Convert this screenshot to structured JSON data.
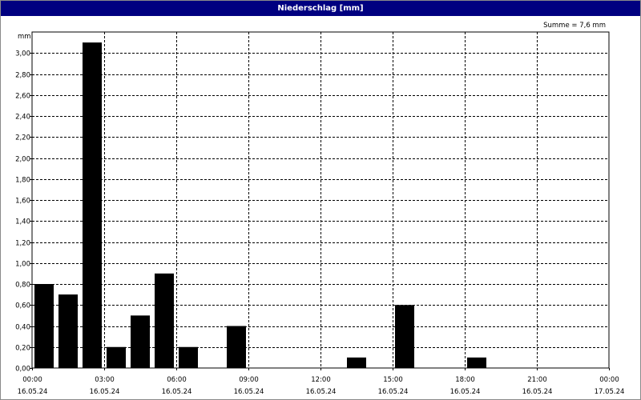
{
  "window": {
    "title": "Niederschlag [mm]"
  },
  "chart_data": {
    "type": "bar",
    "title": "Niederschlag [mm]",
    "ylabel": "mm",
    "summary": "Summe = 7,6 mm",
    "ylim": [
      0,
      3.2
    ],
    "xlim_hours": [
      0,
      24
    ],
    "grid": true,
    "bar_color": "#000000",
    "y_ticks": [
      {
        "value": 0.0,
        "label": "0,00"
      },
      {
        "value": 0.2,
        "label": "0,20"
      },
      {
        "value": 0.4,
        "label": "0,40"
      },
      {
        "value": 0.6,
        "label": "0,60"
      },
      {
        "value": 0.8,
        "label": "0,80"
      },
      {
        "value": 1.0,
        "label": "1,00"
      },
      {
        "value": 1.2,
        "label": "1,20"
      },
      {
        "value": 1.4,
        "label": "1,40"
      },
      {
        "value": 1.6,
        "label": "1,60"
      },
      {
        "value": 1.8,
        "label": "1,80"
      },
      {
        "value": 2.0,
        "label": "2,00"
      },
      {
        "value": 2.2,
        "label": "2,20"
      },
      {
        "value": 2.4,
        "label": "2,40"
      },
      {
        "value": 2.6,
        "label": "2,60"
      },
      {
        "value": 2.8,
        "label": "2,80"
      },
      {
        "value": 3.0,
        "label": "3,00"
      }
    ],
    "x_ticks": [
      {
        "hour": 0,
        "time": "00:00",
        "date": "16.05.24"
      },
      {
        "hour": 3,
        "time": "03:00",
        "date": "16.05.24"
      },
      {
        "hour": 6,
        "time": "06:00",
        "date": "16.05.24"
      },
      {
        "hour": 9,
        "time": "09:00",
        "date": "16.05.24"
      },
      {
        "hour": 12,
        "time": "12:00",
        "date": "16.05.24"
      },
      {
        "hour": 15,
        "time": "15:00",
        "date": "16.05.24"
      },
      {
        "hour": 18,
        "time": "18:00",
        "date": "16.05.24"
      },
      {
        "hour": 21,
        "time": "21:00",
        "date": "16.05.24"
      },
      {
        "hour": 24,
        "time": "00:00",
        "date": "17.05.24"
      }
    ],
    "categories": [
      "00:00",
      "01:00",
      "02:00",
      "03:00",
      "04:00",
      "05:00",
      "06:00",
      "07:00",
      "08:00",
      "09:00",
      "10:00",
      "11:00",
      "12:00",
      "13:00",
      "14:00",
      "15:00",
      "16:00",
      "17:00",
      "18:00",
      "19:00",
      "20:00",
      "21:00",
      "22:00",
      "23:00"
    ],
    "values": [
      0.8,
      0.7,
      3.1,
      0.2,
      0.5,
      0.9,
      0.2,
      0.0,
      0.4,
      0.0,
      0.0,
      0.0,
      0.0,
      0.1,
      0.0,
      0.6,
      0.0,
      0.0,
      0.1,
      0.0,
      0.0,
      0.0,
      0.0,
      0.0
    ]
  }
}
